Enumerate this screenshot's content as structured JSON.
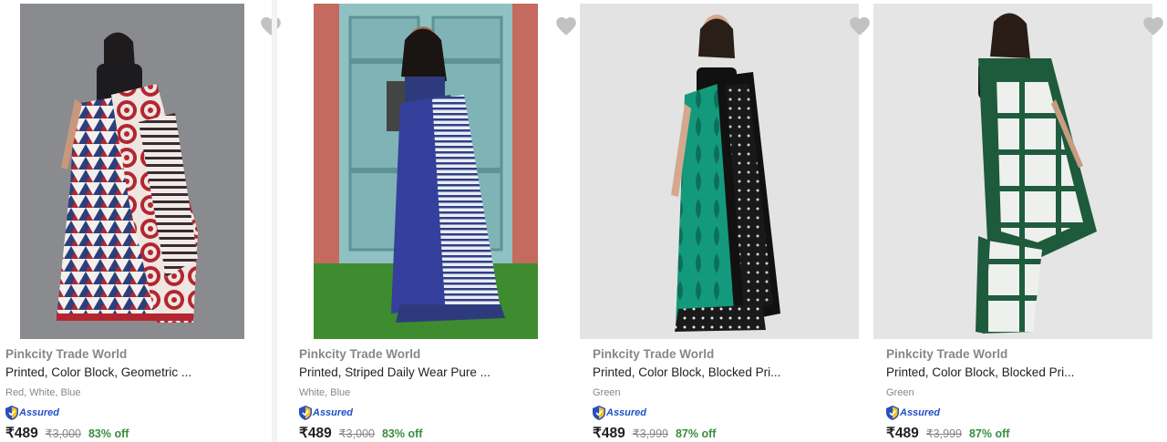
{
  "products": [
    {
      "brand": "Pinkcity Trade World",
      "title": "Printed, Color Block, Geometric ...",
      "color": "Red, White, Blue",
      "assured": "Assured",
      "price": "₹489",
      "mrp": "₹3,000",
      "discount": "83% off",
      "image": "saree-red-white-blue-icon"
    },
    {
      "brand": "Pinkcity Trade World",
      "title": "Printed, Striped Daily Wear Pure ...",
      "color": "White, Blue",
      "assured": "Assured",
      "price": "₹489",
      "mrp": "₹3,000",
      "discount": "83% off",
      "image": "saree-blue-striped-icon"
    },
    {
      "brand": "Pinkcity Trade World",
      "title": "Printed, Color Block, Blocked Pri...",
      "color": "Green",
      "assured": "Assured",
      "price": "₹489",
      "mrp": "₹3,999",
      "discount": "87% off",
      "image": "saree-green-black-icon"
    },
    {
      "brand": "Pinkcity Trade World",
      "title": "Printed, Color Block, Blocked Pri...",
      "color": "Green",
      "assured": "Assured",
      "price": "₹489",
      "mrp": "₹3,999",
      "discount": "87% off",
      "image": "saree-green-white-icon"
    }
  ],
  "colors": {
    "brand_text": "#878787",
    "discount": "#388e3c",
    "assured_blue": "#1f4fc7",
    "heart": "#c2c2c2"
  }
}
